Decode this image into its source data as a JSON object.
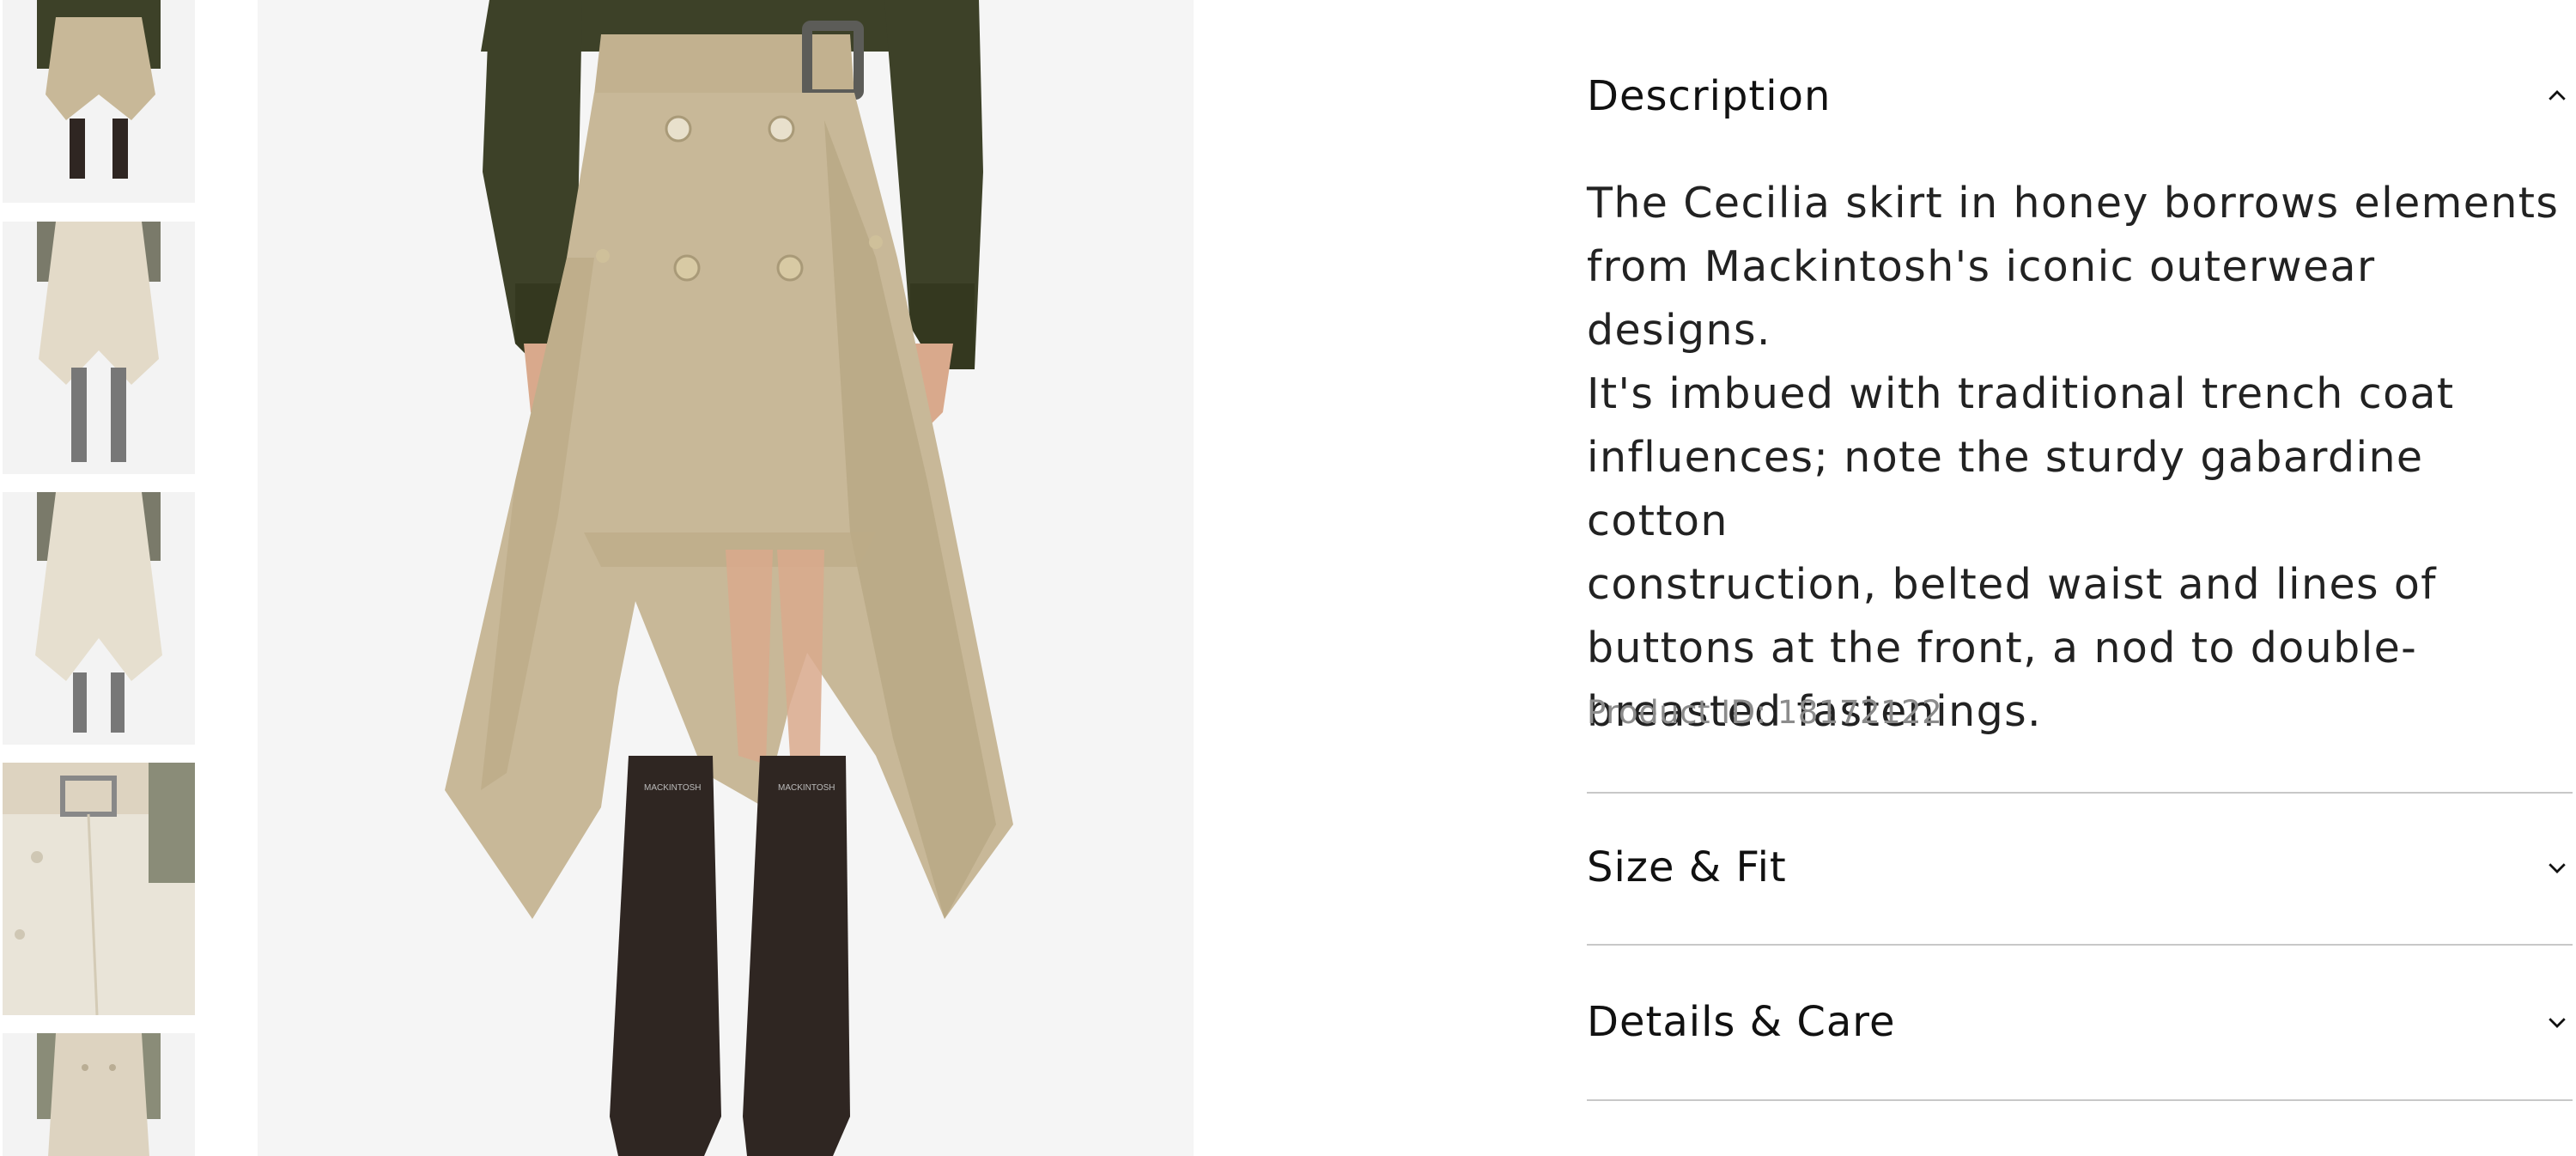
{
  "thumbnails": [
    {
      "label": "Skirt front view with boots"
    },
    {
      "label": "Skirt front view with grey boots"
    },
    {
      "label": "Skirt front view alternate"
    },
    {
      "label": "Belt and buttons close-up"
    },
    {
      "label": "Skirt detail view"
    }
  ],
  "product": {
    "image_alt": "Cecilia skirt in honey worn with dark sweater and rubber boots",
    "boot_brand": "MACKINTOSH",
    "product_id_label": "Product ID:",
    "product_id": "18172122"
  },
  "accordion": {
    "description": {
      "title": "Description",
      "expanded": true,
      "lines": [
        "The Cecilia skirt in honey borrows elements",
        "from Mackintosh's iconic outerwear designs.",
        "It's imbued with traditional trench coat",
        "influences; note the sturdy gabardine cotton",
        "construction, belted waist and lines of",
        "buttons at the front, a nod to double-",
        "breasted fastenings."
      ]
    },
    "size_fit": {
      "title": "Size & Fit",
      "expanded": false
    },
    "details_care": {
      "title": "Details & Care",
      "expanded": false
    }
  },
  "icons": {
    "expanded": "chevron-up-icon",
    "collapsed": "chevron-down-icon"
  },
  "colors": {
    "skirt": "#c8b898",
    "skirt_shadow": "#b3a17d",
    "sweater": "#3d4128",
    "boots": "#2f2622",
    "skin": "#d9a98c",
    "divider": "#c8c8c8",
    "muted_text": "#8c8c8c"
  }
}
